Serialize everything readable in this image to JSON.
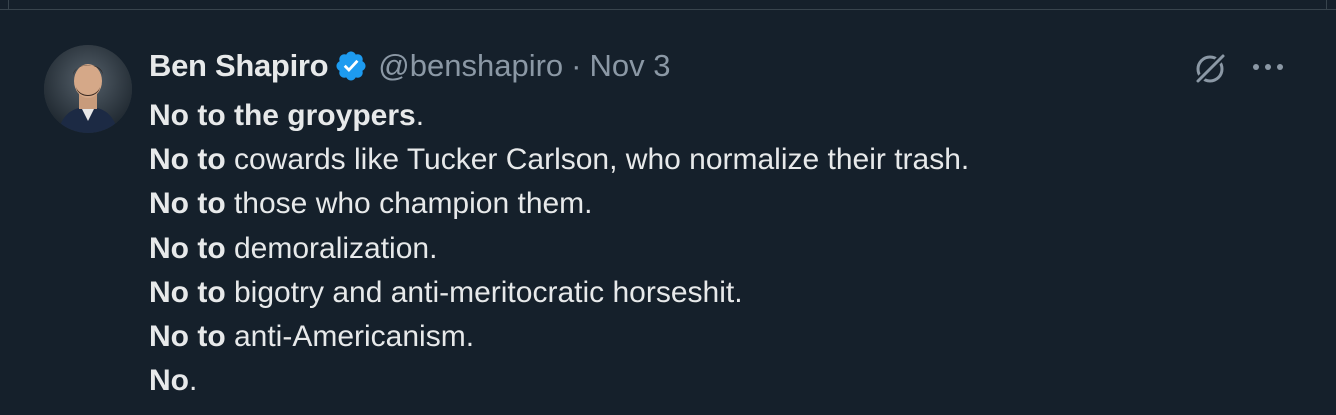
{
  "tweet": {
    "author_name": "Ben Shapiro",
    "handle": "@benshapiro",
    "separator": "·",
    "date": "Nov 3",
    "verified_icon": "verified-badge-icon",
    "grok_icon": "grok-icon",
    "more_icon": "more-icon",
    "colors": {
      "background": "#15202b",
      "text": "#e7e9ea",
      "muted": "#8b98a5",
      "verified": "#1d9bf0"
    },
    "lines": [
      {
        "bold": "No to the groypers",
        "rest": "."
      },
      {
        "bold": "No to",
        "rest": " cowards like Tucker Carlson, who normalize their trash."
      },
      {
        "bold": "No to",
        "rest": " those who champion them."
      },
      {
        "bold": "No to",
        "rest": " demoralization."
      },
      {
        "bold": "No to",
        "rest": " bigotry and anti-meritocratic horseshit."
      },
      {
        "bold": "No to",
        "rest": " anti-Americanism."
      },
      {
        "bold": "No",
        "rest": "."
      }
    ]
  }
}
